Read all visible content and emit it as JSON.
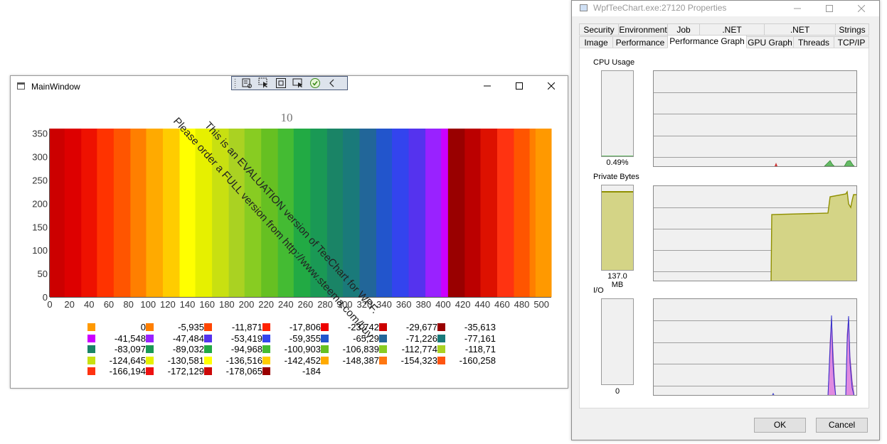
{
  "main_window": {
    "title": "MainWindow",
    "chart": {
      "title": "10",
      "watermark_line1": "This is an EVALUATION version of TeeChart for WPF.",
      "watermark_line2": "Please order a FULL version from http://www.steema.com/buy"
    },
    "legend": [
      {
        "value": "0",
        "color": "#FF9900"
      },
      {
        "value": "-5,935",
        "color": "#FF7F00"
      },
      {
        "value": "-11,871",
        "color": "#FF4500"
      },
      {
        "value": "-17,806",
        "color": "#FF2200"
      },
      {
        "value": "-23,742",
        "color": "#EE0000"
      },
      {
        "value": "-29,677",
        "color": "#CC0000"
      },
      {
        "value": "-35,613",
        "color": "#990000"
      },
      {
        "value": "-41,548",
        "color": "#CC00FF"
      },
      {
        "value": "-47,484",
        "color": "#9922FF"
      },
      {
        "value": "-53,419",
        "color": "#5533EE"
      },
      {
        "value": "-59,355",
        "color": "#3344EE"
      },
      {
        "value": "-65,29",
        "color": "#2255CC"
      },
      {
        "value": "-71,226",
        "color": "#226699"
      },
      {
        "value": "-77,161",
        "color": "#1A7A7A"
      },
      {
        "value": "-83,097",
        "color": "#1A8466"
      },
      {
        "value": "-89,032",
        "color": "#1A9955"
      },
      {
        "value": "-94,968",
        "color": "#22AA44"
      },
      {
        "value": "-100,903",
        "color": "#44BB33"
      },
      {
        "value": "-106,839",
        "color": "#66C022"
      },
      {
        "value": "-112,774",
        "color": "#88CC22"
      },
      {
        "value": "-118,71",
        "color": "#AAD222"
      },
      {
        "value": "-124,645",
        "color": "#C8E011"
      },
      {
        "value": "-130,581",
        "color": "#E6F000"
      },
      {
        "value": "-136,516",
        "color": "#FFFF00"
      },
      {
        "value": "-142,452",
        "color": "#FFCC00"
      },
      {
        "value": "-148,387",
        "color": "#FFAA00"
      },
      {
        "value": "-154,323",
        "color": "#FF7711"
      },
      {
        "value": "-160,258",
        "color": "#FF5511"
      },
      {
        "value": "-166,194",
        "color": "#FF3311"
      },
      {
        "value": "-172,129",
        "color": "#EE1111"
      },
      {
        "value": "-178,065",
        "color": "#CC0808"
      },
      {
        "value": "-184",
        "color": "#990000"
      }
    ]
  },
  "chart_data": {
    "type": "heatmap",
    "title": "10",
    "xlim": [
      0,
      510
    ],
    "ylim": [
      0,
      360
    ],
    "x_ticks": [
      0,
      20,
      40,
      60,
      80,
      100,
      120,
      140,
      160,
      180,
      200,
      220,
      240,
      260,
      280,
      300,
      320,
      340,
      360,
      380,
      400,
      420,
      440,
      460,
      480,
      500
    ],
    "y_ticks": [
      0,
      50,
      100,
      150,
      200,
      250,
      300,
      350
    ],
    "bands": [
      {
        "x0": 0,
        "x1": 15,
        "color": "#CC0000"
      },
      {
        "x0": 15,
        "x1": 32,
        "color": "#DD0000"
      },
      {
        "x0": 32,
        "x1": 48,
        "color": "#EE1100"
      },
      {
        "x0": 48,
        "x1": 65,
        "color": "#FF3300"
      },
      {
        "x0": 65,
        "x1": 82,
        "color": "#FF5500"
      },
      {
        "x0": 82,
        "x1": 98,
        "color": "#FF7F00"
      },
      {
        "x0": 98,
        "x1": 115,
        "color": "#FFAA00"
      },
      {
        "x0": 115,
        "x1": 132,
        "color": "#FFCC00"
      },
      {
        "x0": 132,
        "x1": 148,
        "color": "#FFFF00"
      },
      {
        "x0": 148,
        "x1": 165,
        "color": "#E6F000"
      },
      {
        "x0": 165,
        "x1": 182,
        "color": "#C8E011"
      },
      {
        "x0": 182,
        "x1": 198,
        "color": "#AAD222"
      },
      {
        "x0": 198,
        "x1": 215,
        "color": "#88CC22"
      },
      {
        "x0": 215,
        "x1": 232,
        "color": "#66C022"
      },
      {
        "x0": 232,
        "x1": 248,
        "color": "#44BB33"
      },
      {
        "x0": 248,
        "x1": 265,
        "color": "#22AA44"
      },
      {
        "x0": 265,
        "x1": 282,
        "color": "#1A9955"
      },
      {
        "x0": 282,
        "x1": 298,
        "color": "#1A8466"
      },
      {
        "x0": 298,
        "x1": 315,
        "color": "#1A7A7A"
      },
      {
        "x0": 315,
        "x1": 332,
        "color": "#226699"
      },
      {
        "x0": 332,
        "x1": 348,
        "color": "#2255CC"
      },
      {
        "x0": 348,
        "x1": 365,
        "color": "#3344EE"
      },
      {
        "x0": 365,
        "x1": 382,
        "color": "#5533EE"
      },
      {
        "x0": 382,
        "x1": 398,
        "color": "#9922FF"
      },
      {
        "x0": 398,
        "x1": 405,
        "color": "#CC00FF"
      },
      {
        "x0": 405,
        "x1": 422,
        "color": "#990000"
      },
      {
        "x0": 422,
        "x1": 438,
        "color": "#BB0000"
      },
      {
        "x0": 438,
        "x1": 455,
        "color": "#DD1100"
      },
      {
        "x0": 455,
        "x1": 472,
        "color": "#FF3311"
      },
      {
        "x0": 472,
        "x1": 488,
        "color": "#FF5500"
      },
      {
        "x0": 488,
        "x1": 494,
        "color": "#FF7F00"
      },
      {
        "x0": 494,
        "x1": 510,
        "color": "#FF9900"
      }
    ]
  },
  "properties_window": {
    "title": "WpfTeeChart.exe:27120 Properties",
    "tabs_row1": [
      "Security",
      "Environment",
      "Job",
      ".NET Assemblies",
      ".NET Performance",
      "Strings"
    ],
    "tabs_row2": [
      "Image",
      "Performance",
      "Performance Graph",
      "GPU Graph",
      "Threads",
      "TCP/IP"
    ],
    "active_tab": "Performance Graph",
    "cpu": {
      "label": "CPU Usage",
      "value": "0.49%",
      "fill": 0.0049
    },
    "private_bytes": {
      "label": "Private Bytes",
      "value": "137.0 MB",
      "fill": 0.92
    },
    "io": {
      "label": "I/O",
      "value": "0",
      "fill": 0
    },
    "ok_label": "OK",
    "cancel_label": "Cancel",
    "colors": {
      "cpu_green": "#66bb66",
      "cpu_red": "#cc3333",
      "bytes_fill": "#d4d486",
      "bytes_line": "#8f8f00",
      "io_fill": "#e08ae0",
      "io_line": "#3333cc"
    }
  }
}
